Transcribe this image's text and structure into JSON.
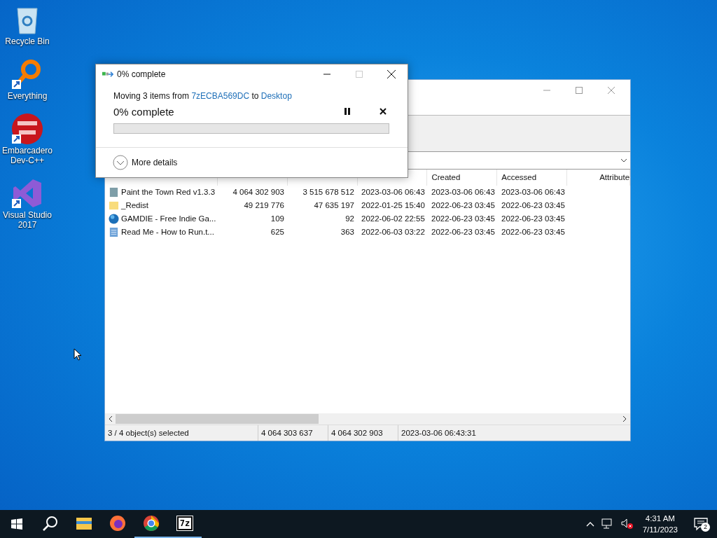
{
  "desktop_icons": [
    {
      "label": "Recycle Bin",
      "kind": "bin",
      "shortcut": false
    },
    {
      "label": "Everything",
      "kind": "magnifier",
      "shortcut": true
    },
    {
      "label": "Embarcadero Dev-C++",
      "kind": "devcpp",
      "shortcut": true
    },
    {
      "label": "Visual Studio 2017",
      "kind": "vs",
      "shortcut": true
    }
  ],
  "archive_window": {
    "columns": [
      {
        "label": "Created"
      },
      {
        "label": "Accessed"
      },
      {
        "label": "Attribute"
      }
    ],
    "rows": [
      {
        "kind": "app",
        "name": "Paint the Town Red v1.3.3",
        "size": "4 064 302 903",
        "packed_size": "3 515 678 512",
        "modified": "2023-03-06 06:43",
        "created": "2023-03-06 06:43",
        "accessed": "2023-03-06 06:43"
      },
      {
        "kind": "folder",
        "name": "_Redist",
        "size": "49 219 776",
        "packed_size": "47 635 197",
        "modified": "2022-01-25 15:40",
        "created": "2022-06-23 03:45",
        "accessed": "2022-06-23 03:45"
      },
      {
        "kind": "web",
        "name": "GAMDIE - Free Indie Ga...",
        "size": "109",
        "packed_size": "92",
        "modified": "2022-06-02 22:55",
        "created": "2022-06-23 03:45",
        "accessed": "2022-06-23 03:45"
      },
      {
        "kind": "text",
        "name": "Read Me - How to Run.t...",
        "size": "625",
        "packed_size": "363",
        "modified": "2022-06-03 03:22",
        "created": "2022-06-23 03:45",
        "accessed": "2022-06-23 03:45"
      }
    ],
    "status_bar": [
      "3 / 4 object(s) selected",
      "4 064 303 637",
      "4 064 302 903",
      "2023-03-06 06:43:31"
    ]
  },
  "progress_dialog": {
    "title": "0% complete",
    "message": {
      "before": "Moving 3 items from ",
      "source": "7zECBA569DC",
      "middle": " to ",
      "destination": "Desktop"
    },
    "heading": "0% complete",
    "details": "More details"
  },
  "taskbar": {
    "apps": [
      {
        "kind": "search",
        "running": false
      },
      {
        "kind": "explorer",
        "running": false
      },
      {
        "kind": "firefox",
        "running": false
      },
      {
        "kind": "chrome",
        "running": true
      },
      {
        "kind": "sevenzip",
        "label": "7z",
        "running": true
      }
    ],
    "time": "4:31 AM",
    "date": "7/11/2023",
    "notifications": "2"
  }
}
